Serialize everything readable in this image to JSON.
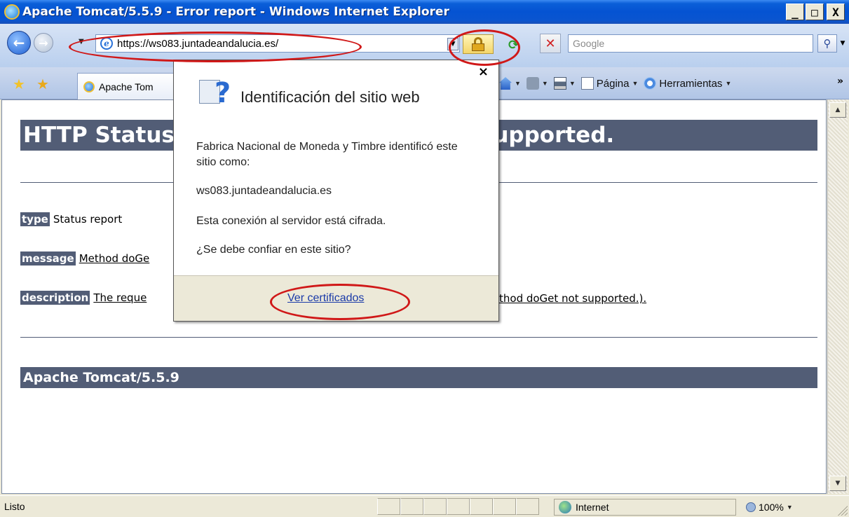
{
  "window": {
    "title": "Apache Tomcat/5.5.9 - Error report - Windows Internet Explorer",
    "minimize": "_",
    "maximize": "□",
    "close": "X"
  },
  "addressbar": {
    "url": "https://ws083.juntadeandalucia.es/",
    "search_placeholder": "Google"
  },
  "tabs": [
    {
      "label": "Apache Tom"
    }
  ],
  "commandbar": {
    "page_label": "Página",
    "tools_label": "Herramientas"
  },
  "page": {
    "heading_left": "HTTP Status",
    "heading_right": "supported.",
    "type_label": "type",
    "type_value": "Status report",
    "message_label": "message",
    "message_value": "Method doGe",
    "description_label": "description",
    "description_value": "The reque",
    "description_tail": "thod doGet not supported.).",
    "footer_heading": "Apache Tomcat/5.5.9"
  },
  "popup": {
    "title": "Identificación del sitio web",
    "issuer_text": "Fabrica Nacional de Moneda y Timbre identificó este sitio como:",
    "site": "ws083.juntadeandalucia.es",
    "encrypted_text": "Esta conexión al servidor está cifrada.",
    "trust_question": "¿Se debe confiar en este sitio?",
    "view_certs_link": "Ver certificados",
    "close_glyph": "×"
  },
  "statusbar": {
    "status": "Listo",
    "zone": "Internet",
    "zoom": "100%"
  },
  "colors": {
    "tomcat_header": "#525d76",
    "annotation_red": "#d01818",
    "link": "#1a3aa8"
  }
}
